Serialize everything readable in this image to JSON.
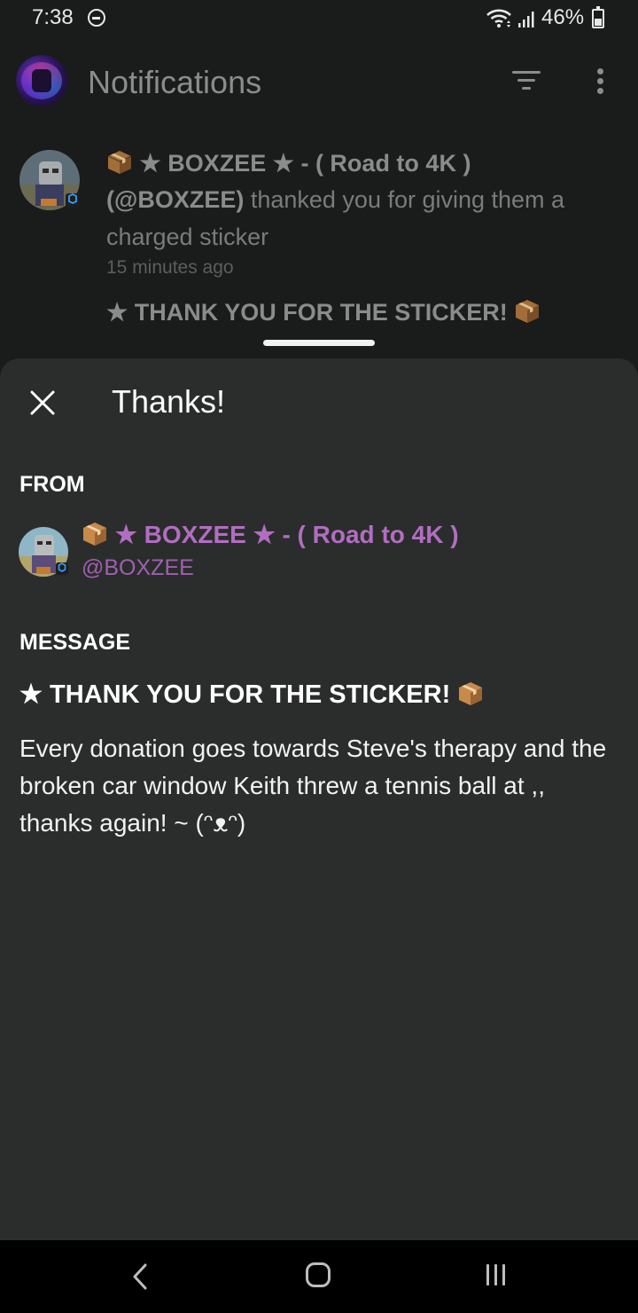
{
  "status_bar": {
    "time": "7:38",
    "battery": "46%",
    "icons": [
      "do-not-disturb-icon",
      "wifi-icon",
      "signal-icon",
      "battery-icon"
    ]
  },
  "app_bar": {
    "title": "Notifications",
    "icons": [
      "app-avatar",
      "filter-icon",
      "more-vert-icon"
    ]
  },
  "notification": {
    "title": "★ BOXZEE ★ - ( Road to 4K )",
    "handle": "(@BOXZEE)",
    "action": " thanked you for giving them a charged sticker",
    "time": "15 minutes ago",
    "message": "★ THANK YOU FOR THE STICKER!"
  },
  "sheet": {
    "title": "Thanks!",
    "from_label": "FROM",
    "from_name": "★ BOXZEE ★ - ( Road to 4K )",
    "from_handle": "@BOXZEE",
    "message_label": "MESSAGE",
    "message_title": "★ THANK YOU FOR THE STICKER!",
    "message_body": "Every donation goes towards Steve's therapy and the broken car window Keith threw a tennis ball at ,, thanks again! ~ (ᵔᴥᵔ)"
  },
  "colors": {
    "background": "#1a1b1b",
    "sheet": "#2a2d2c",
    "accent_purple": "#b26dc2"
  },
  "nav_bar": {
    "icons": [
      "back-icon",
      "home-icon",
      "recents-icon"
    ]
  }
}
